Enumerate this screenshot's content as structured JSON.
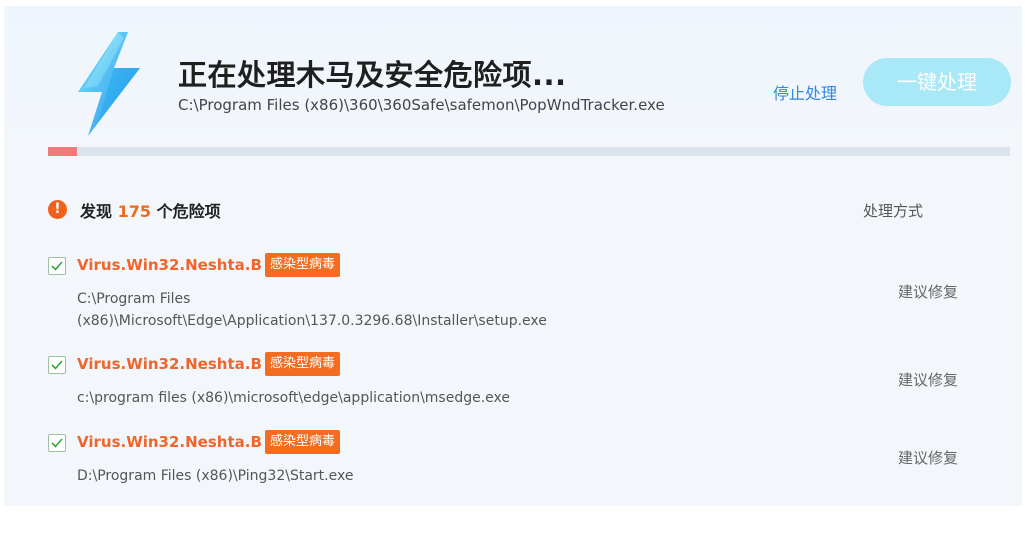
{
  "header": {
    "title": "正在处理木马及安全危险项...",
    "current_path": "C:\\Program Files (x86)\\360\\360Safe\\safemon\\PopWndTracker.exe",
    "stop_label": "停止处理",
    "fix_all_label": "一键处理",
    "progress_fraction": 0.03,
    "colors": {
      "accent": "#2f87e6",
      "danger": "#f0652a",
      "button_disabled": "#a8e8f7"
    }
  },
  "summary": {
    "prefix": "发现",
    "count": "175",
    "suffix": "个危险项",
    "method_header": "处理方式",
    "icon": "warning-icon"
  },
  "items": [
    {
      "name": "Virus.Win32.Neshta.B",
      "tag": "感染型病毒",
      "path": "C:\\Program Files (x86)\\Microsoft\\Edge\\Application\\137.0.3296.68\\Installer\\setup.exe",
      "action": "建议修复",
      "checked": true
    },
    {
      "name": "Virus.Win32.Neshta.B",
      "tag": "感染型病毒",
      "path": "c:\\program files (x86)\\microsoft\\edge\\application\\msedge.exe",
      "action": "建议修复",
      "checked": true
    },
    {
      "name": "Virus.Win32.Neshta.B",
      "tag": "感染型病毒",
      "path": "D:\\Program Files (x86)\\Ping32\\Start.exe",
      "action": "建议修复",
      "checked": true
    }
  ]
}
